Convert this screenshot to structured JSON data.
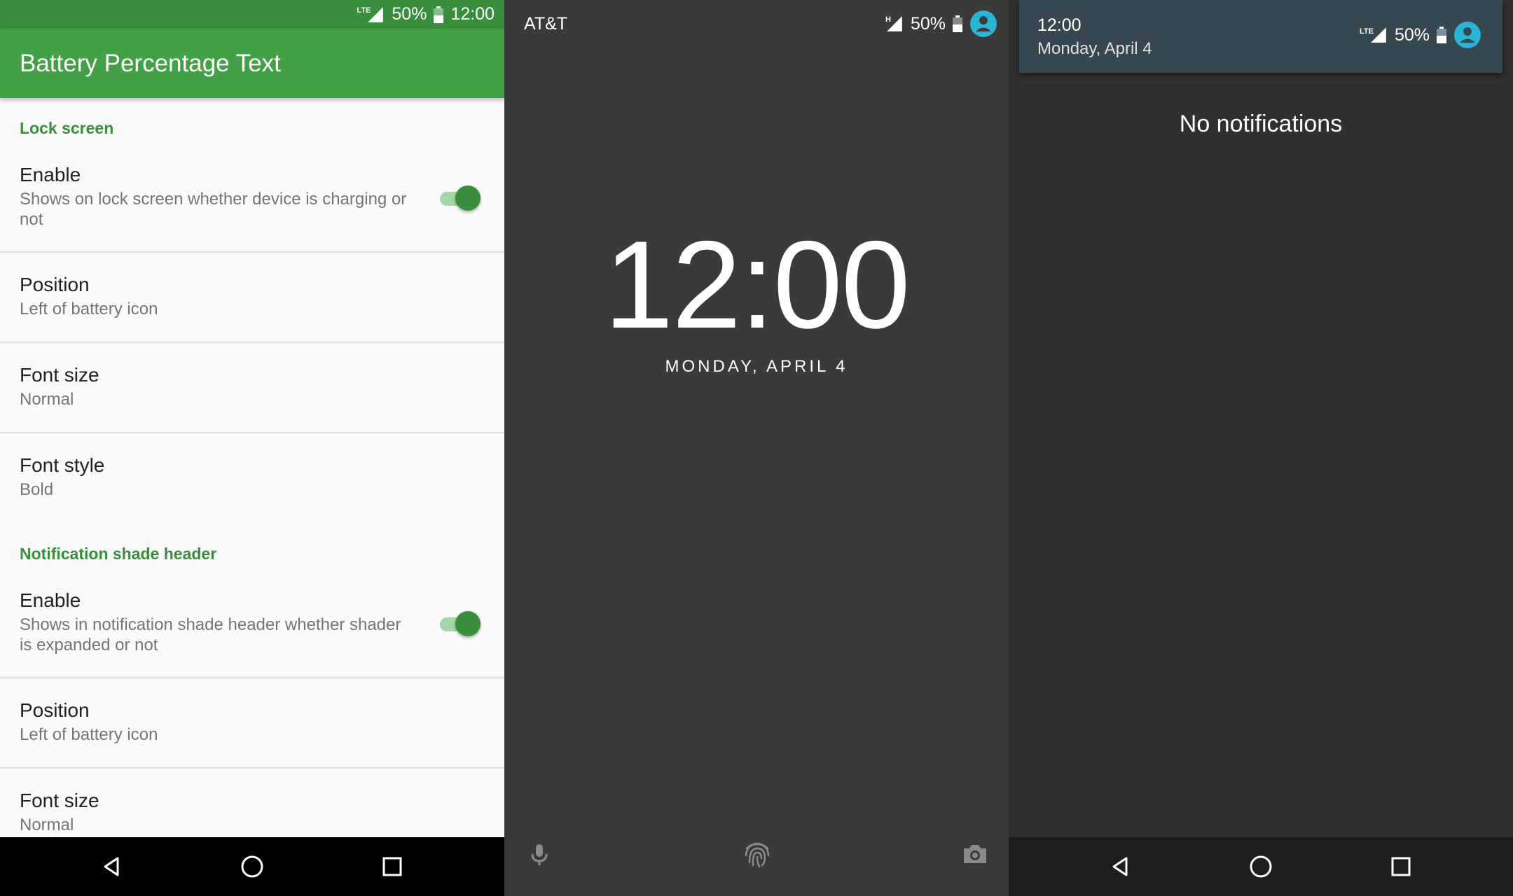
{
  "panel1": {
    "status_bar": {
      "network": "LTE",
      "battery": "50%",
      "time": "12:00"
    },
    "title": "Battery Percentage Text",
    "sections": [
      {
        "header": "Lock screen",
        "items": [
          {
            "title": "Enable",
            "summary": "Shows on lock screen whether device is charging or not",
            "toggle": true
          },
          {
            "title": "Position",
            "summary": "Left of battery icon"
          },
          {
            "title": "Font size",
            "summary": "Normal"
          },
          {
            "title": "Font style",
            "summary": "Bold"
          }
        ]
      },
      {
        "header": "Notification shade header",
        "items": [
          {
            "title": "Enable",
            "summary": "Shows in notification shade header whether shader is expanded or not",
            "toggle": true
          },
          {
            "title": "Position",
            "summary": "Left of battery icon"
          },
          {
            "title": "Font size",
            "summary": "Normal"
          }
        ]
      }
    ],
    "nav": [
      "back-icon",
      "home-icon",
      "recents-icon"
    ]
  },
  "panel2": {
    "carrier": "AT&T",
    "status_bar": {
      "network": "H",
      "battery": "50%"
    },
    "clock": "12:00",
    "date": "MONDAY, APRIL 4",
    "bottom_icons": [
      "microphone-icon",
      "fingerprint-icon",
      "camera-icon"
    ]
  },
  "panel3": {
    "header": {
      "time": "12:00",
      "date": "Monday, April 4",
      "network": "LTE",
      "battery": "50%"
    },
    "empty_message": "No notifications",
    "nav": [
      "back-icon",
      "home-icon",
      "recents-icon"
    ]
  },
  "colors": {
    "primary": "#43a047",
    "primary_dark": "#388e3c",
    "accent_avatar": "#29b6d6",
    "lockscreen_bg": "#3a3a3a",
    "shade_bg": "#303030",
    "qs_header": "#37474f"
  }
}
